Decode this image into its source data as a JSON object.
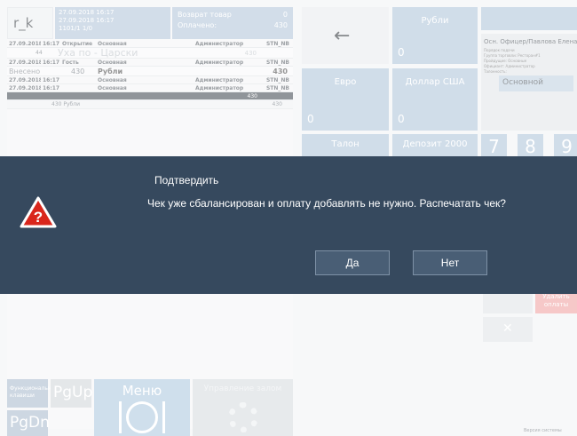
{
  "receipt": {
    "user": "r_k",
    "dates": [
      "27.09.2018 16:17",
      "27.09.2018 16:17",
      "1101/1          1/0"
    ],
    "totals": [
      {
        "label": "Возврат товар",
        "value": "0"
      },
      {
        "label": "Оплачено:",
        "value": "430"
      }
    ],
    "rows": [
      [
        "27.09.2018",
        "16:17",
        "Открытие",
        "Основная",
        "Администратор",
        "STN_NB"
      ],
      [
        "27.09.2018",
        "16:17",
        "Гость",
        "Основная",
        "Администратор",
        "STN_NB"
      ]
    ],
    "item": {
      "qty": "44",
      "name": "Уха по - Царски",
      "sum": "430"
    },
    "paid": {
      "label": "Внесено",
      "amount": "430",
      "currency": "Рубли",
      "total": "430"
    },
    "rows2": [
      [
        "27.09.2018",
        "16:17",
        "",
        "Основная",
        "Администратор",
        "STN_NB"
      ],
      [
        "27.09.2018",
        "16:17",
        "",
        "Основная",
        "Администратор",
        "STN_NB"
      ]
    ],
    "dark_total": "430",
    "summary": {
      "left": "430 Рубли",
      "right": "430"
    }
  },
  "bottom_left": {
    "functions": "Функциональные клавиши",
    "pgup": "PgUp",
    "pgdn": "PgDn",
    "menu": "Меню",
    "settings": "Управление залом"
  },
  "payment": {
    "rub": {
      "label": "Рубли",
      "value": "0"
    },
    "eur": {
      "label": "Евро",
      "value": "0"
    },
    "usd": {
      "label": "Доллар США",
      "value": "0"
    },
    "talon": "Талон",
    "deposit": "Депозит 2000",
    "keys": [
      "7",
      "8",
      "9"
    ],
    "info": {
      "title": "Осн. Офицер/Павлова Елена",
      "lines": [
        "Порядок подачи",
        "Группа торговли: Ресторан#1",
        "Пройдущие: Основные",
        "Официант: Администратор",
        "Талонность:"
      ],
      "zone": "Основной"
    },
    "delete_label": "Удалить оплаты",
    "footer": "Версия системы"
  },
  "dialog": {
    "title": "Подтвердить",
    "message": "Чек уже сбалансирован и оплату добавлять не нужно. Распечатать чек?",
    "yes": "Да",
    "no": "Нет",
    "icon_symbol": "?"
  }
}
